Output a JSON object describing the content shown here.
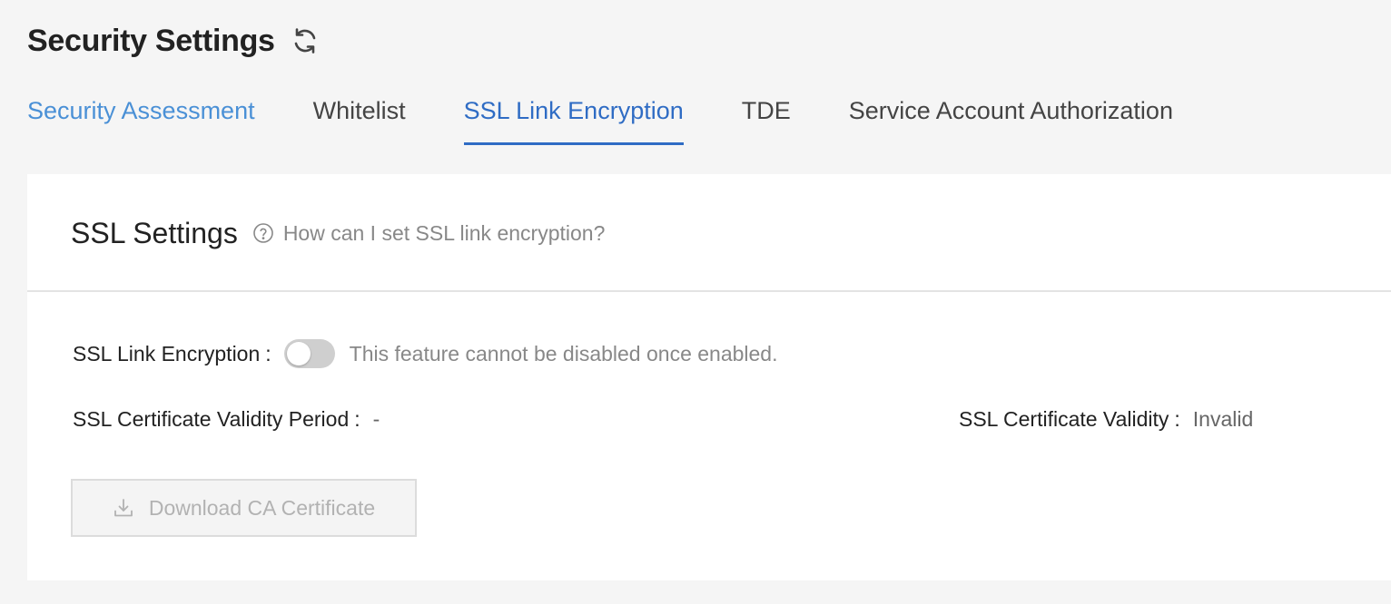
{
  "header": {
    "title": "Security Settings",
    "refresh_icon": "refresh-icon"
  },
  "tabs": [
    {
      "label": "Security Assessment",
      "state": "link"
    },
    {
      "label": "Whitelist",
      "state": "normal"
    },
    {
      "label": "SSL Link Encryption",
      "state": "active"
    },
    {
      "label": "TDE",
      "state": "normal"
    },
    {
      "label": "Service Account Authorization",
      "state": "normal"
    }
  ],
  "card": {
    "title": "SSL Settings",
    "help_icon": "question-circle-icon",
    "help_text": "How can I set SSL link encryption?"
  },
  "ssl_encryption": {
    "label": "SSL Link Encryption",
    "colon": ":",
    "enabled": false,
    "hint": "This feature cannot be disabled once enabled."
  },
  "certificate": {
    "period_label": "SSL Certificate Validity Period",
    "period_colon": ":",
    "period_value": "-",
    "validity_label": "SSL Certificate Validity",
    "validity_colon": ":",
    "validity_value": "Invalid"
  },
  "download": {
    "label": "Download CA Certificate",
    "icon": "download-icon",
    "disabled": true
  },
  "colors": {
    "active_tab": "#2f6cc4",
    "link_tab": "#4a90d6",
    "toggle_off": "#cfcfcf"
  }
}
